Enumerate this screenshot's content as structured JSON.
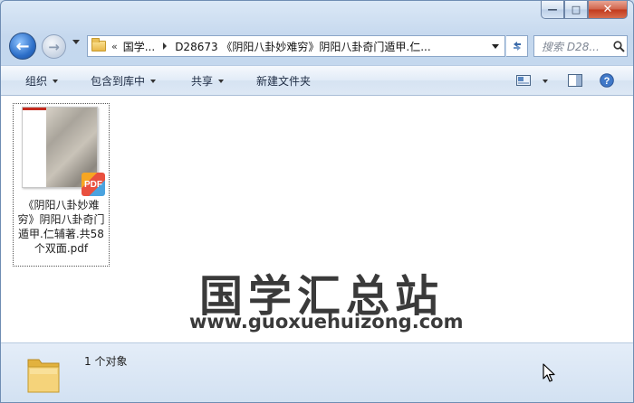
{
  "window": {
    "caption_buttons": {
      "minimize": "—",
      "maximize": "□",
      "close": "✕"
    }
  },
  "nav": {
    "back_glyph": "←",
    "forward_glyph": "→"
  },
  "address": {
    "overflow_chevron": "«",
    "crumbs": [
      "国学...",
      "D28673 《阴阳八卦妙难穷》阴阳八卦奇门遁甲.仁..."
    ]
  },
  "search": {
    "placeholder": "搜索 D28..."
  },
  "toolbar": {
    "organize": "组织",
    "include_library": "包含到库中",
    "share": "共享",
    "new_folder": "新建文件夹"
  },
  "file": {
    "name": "《阴阳八卦妙难穷》阴阳八卦奇门遁甲.仁辅著.共58个双面.pdf",
    "name_lines": [
      "《阴阳八卦妙难",
      "穷》阴阳八卦奇门",
      "遁甲.仁辅著.共58",
      "个双面.pdf"
    ],
    "badge": "PDF"
  },
  "watermark": {
    "title": "国学汇总站",
    "url": "www.guoxuehuizong.com"
  },
  "status": {
    "count_text": "1 个对象"
  },
  "colors": {
    "accent": "#2d6fc8",
    "close_red": "#c2391d",
    "pdf_badge": "#e9503f"
  }
}
